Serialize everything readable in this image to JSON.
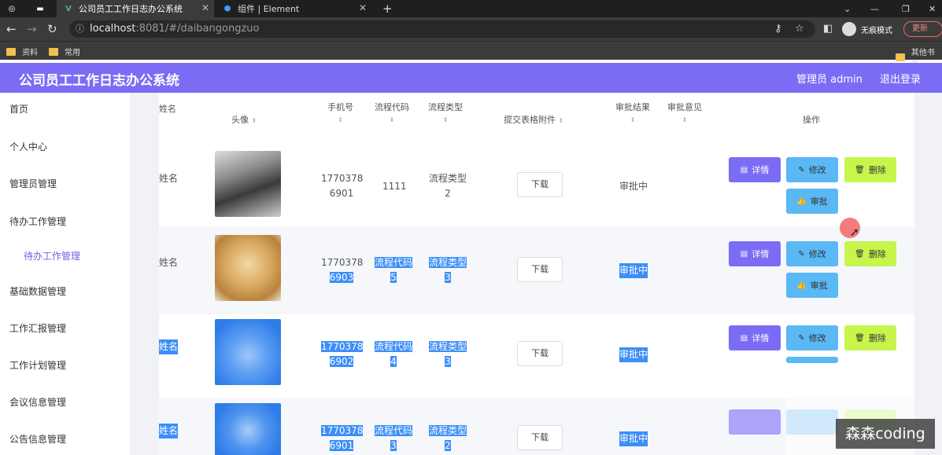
{
  "browser": {
    "tabs": [
      {
        "title": "",
        "active": false
      },
      {
        "title": "",
        "active": false
      },
      {
        "title": "公司员工工作日志办公系统",
        "active": true
      },
      {
        "title": "组件 | Element",
        "active": false
      }
    ],
    "url_host": "localhost",
    "url_path": ":8081/#/daibangongzuo",
    "incognito_label": "无痕模式",
    "update_label": "更新",
    "bookmarks": [
      "资料",
      "常用"
    ],
    "other_bookmarks": "其他书签"
  },
  "header": {
    "title": "公司员工工作日志办公系统",
    "user": "管理员 admin",
    "logout": "退出登录"
  },
  "sidebar": {
    "items": [
      {
        "label": "首页"
      },
      {
        "label": "个人中心"
      },
      {
        "label": "管理员管理"
      },
      {
        "label": "待办工作管理"
      },
      {
        "label": "待办工作管理",
        "sub": true
      },
      {
        "label": "基础数据管理"
      },
      {
        "label": "工作汇报管理"
      },
      {
        "label": "工作计划管理"
      },
      {
        "label": "会议信息管理"
      },
      {
        "label": "公告信息管理"
      }
    ]
  },
  "table": {
    "columns": [
      "姓名",
      "头像",
      "手机号",
      "流程代码",
      "流程类型",
      "提交表格附件",
      "审批结果",
      "审批意见",
      "操作"
    ],
    "rows": [
      {
        "name": "姓名",
        "phone_a": "1770378",
        "phone_b": "6901",
        "code": "1111",
        "type_a": "流程类型",
        "type_b": "2",
        "download": "下载",
        "result": "审批中"
      },
      {
        "name": "姓名",
        "phone_a": "1770378",
        "phone_b": "6903",
        "code_a": "流程代码",
        "code_b": "5",
        "type_a": "流程类型",
        "type_b": "3",
        "download": "下载",
        "result": "审批中"
      },
      {
        "name": "姓名",
        "phone_a": "1770378",
        "phone_b": "6902",
        "code_a": "流程代码",
        "code_b": "4",
        "type_a": "流程类型",
        "type_b": "3",
        "download": "下载",
        "result": "审批中"
      },
      {
        "name": "姓名",
        "phone_a": "1770378",
        "phone_b": "6901",
        "code_a": "流程代码",
        "code_b": "3",
        "type_a": "流程类型",
        "type_b": "2",
        "download": "下载",
        "result": "审批中"
      }
    ],
    "actions": {
      "detail": "详情",
      "edit": "修改",
      "delete": "删除",
      "review": "审批"
    }
  },
  "watermark": "森森coding"
}
